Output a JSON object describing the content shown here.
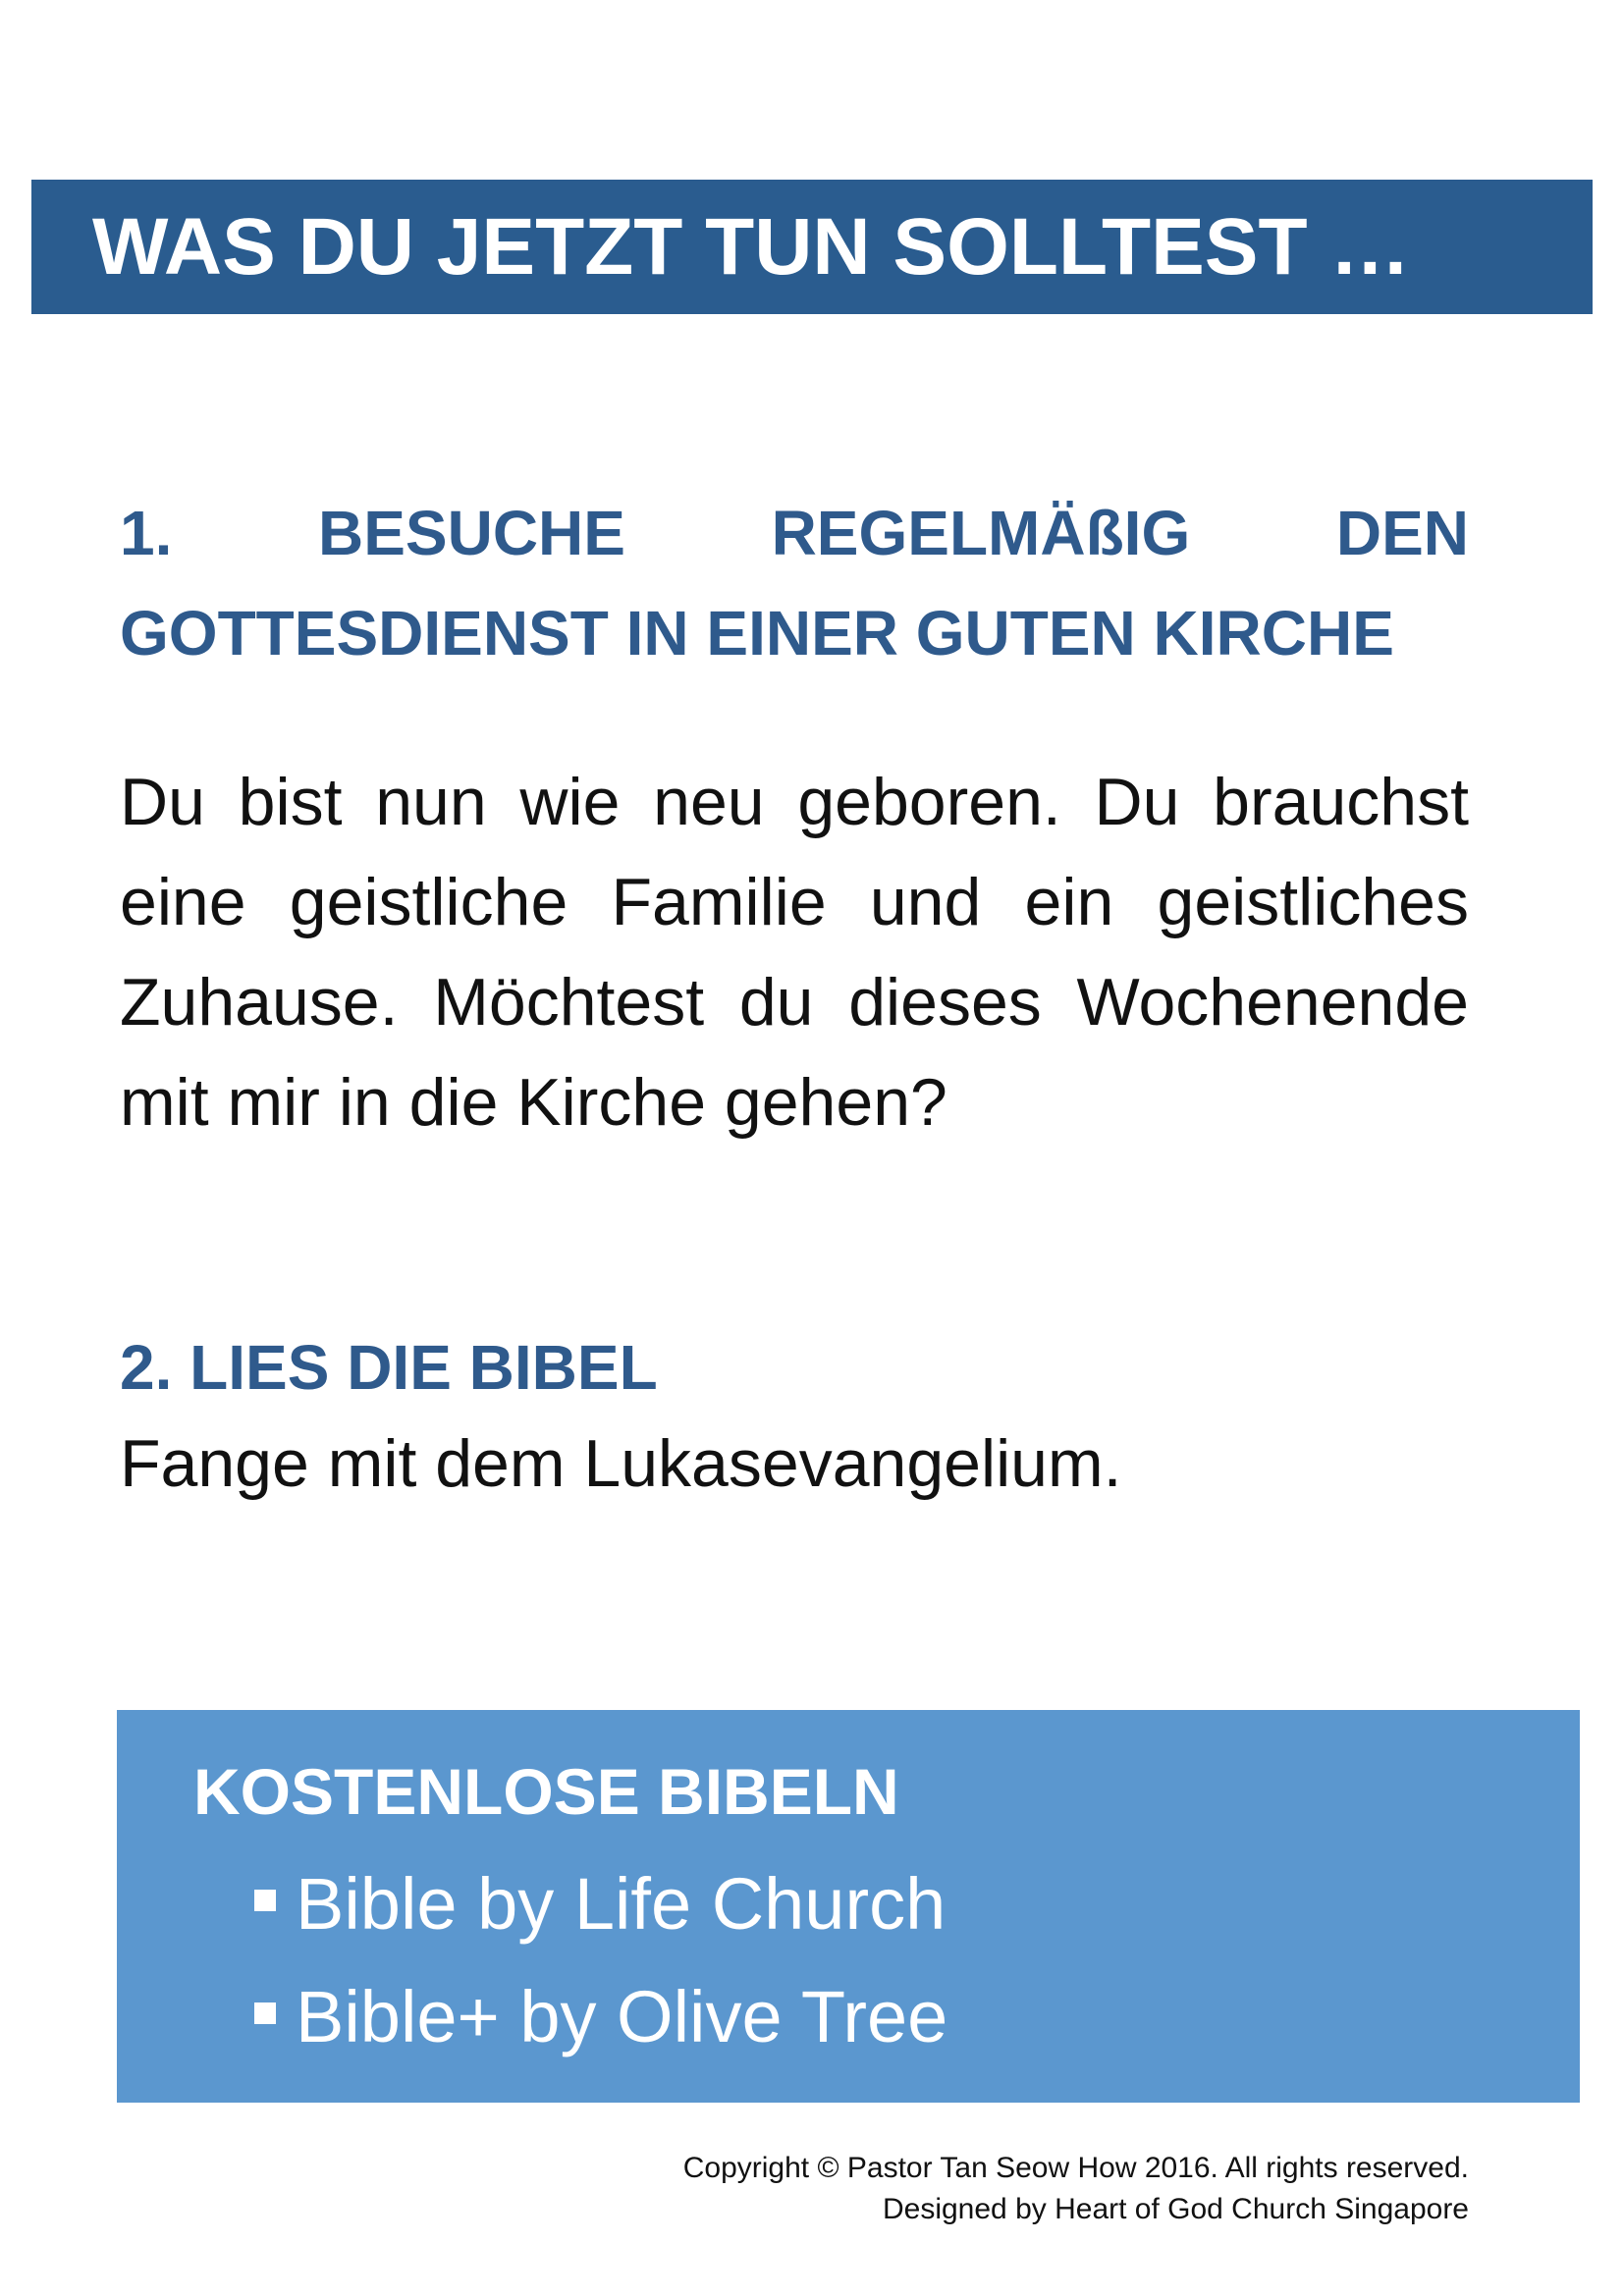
{
  "header": {
    "title": "WAS DU JETZT TUN SOLLTEST …"
  },
  "section1": {
    "heading_line1": "1. BESUCHE REGELMÄßIG DEN",
    "heading_line2": "GOTTESDIENST IN EINER GUTEN KIRCHE",
    "body": "Du bist nun wie neu geboren. Du brauchst eine geistliche Familie und ein geistliches Zuhause. Möchtest du dieses Wochenende mit mir in die Kirche gehen?"
  },
  "section2": {
    "heading": "2. LIES DIE BIBEL",
    "body": "Fange mit dem Lukasevangelium."
  },
  "free_bibles": {
    "title": "KOSTENLOSE BIBELN",
    "items": [
      "Bible by Life Church",
      "Bible+ by Olive Tree"
    ]
  },
  "footer": {
    "copyright": "Copyright © Pastor Tan Seow How 2016. All rights reserved.",
    "designed_by": "Designed by Heart of God Church Singapore"
  },
  "colors": {
    "title_bar": "#2a5c8f",
    "heading": "#2f5a8c",
    "box": "#5b97cf"
  }
}
